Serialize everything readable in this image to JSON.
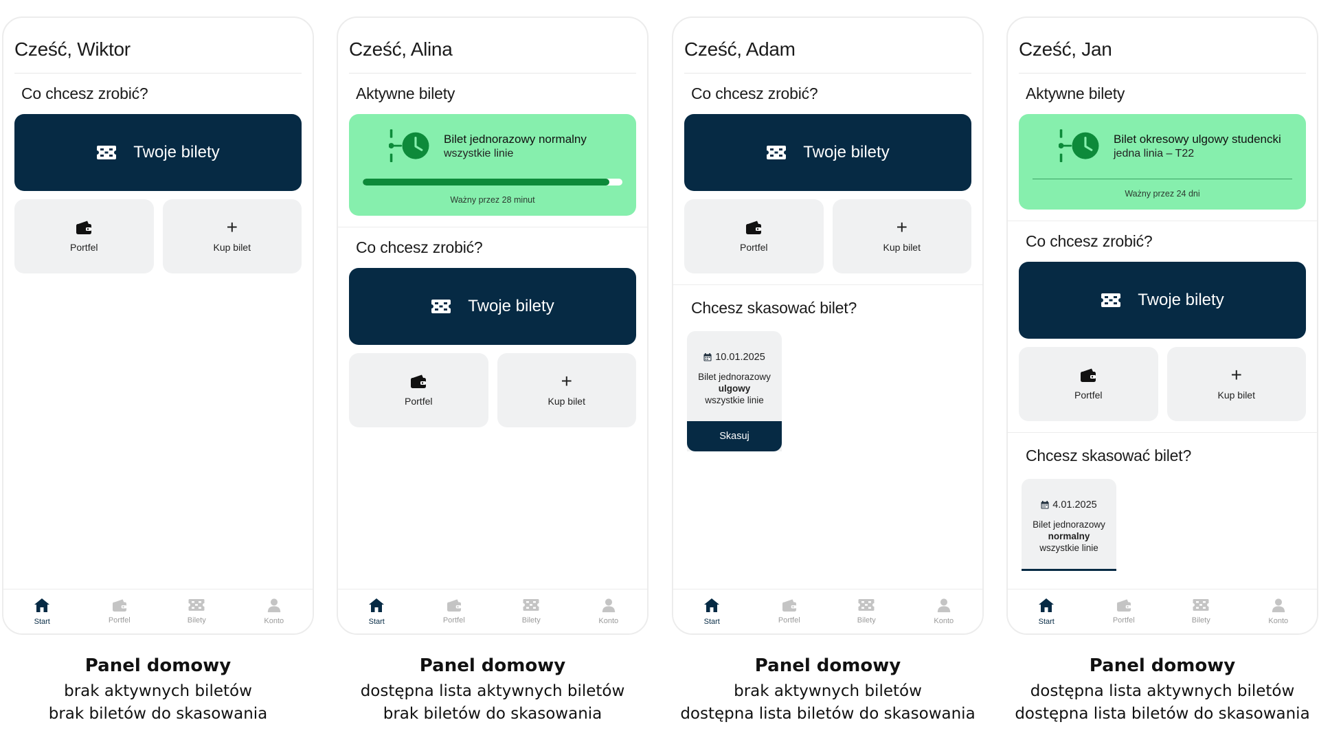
{
  "screens": [
    {
      "greeting": "Cześć, Wiktor",
      "actions_title": "Co chcesz zrobić?",
      "big_button": "Twoje bilety",
      "btn_wallet": "Portfel",
      "btn_buy": "Kup bilet",
      "nav": [
        "Start",
        "Portfel",
        "Bilety",
        "Konto"
      ]
    },
    {
      "greeting": "Cześć, Alina",
      "active_title": "Aktywne bilety",
      "active_ticket": {
        "title": "Bilet jednorazowy normalny",
        "subtitle": "wszystkie linie",
        "valid": "Ważny przez 28 minut",
        "progress": 0.95
      },
      "actions_title": "Co chcesz zrobić?",
      "big_button": "Twoje bilety",
      "btn_wallet": "Portfel",
      "btn_buy": "Kup bilet",
      "nav": [
        "Start",
        "Portfel",
        "Bilety",
        "Konto"
      ]
    },
    {
      "greeting": "Cześć, Adam",
      "actions_title": "Co chcesz zrobić?",
      "big_button": "Twoje bilety",
      "btn_wallet": "Portfel",
      "btn_buy": "Kup bilet",
      "validate_title": "Chcesz skasować bilet?",
      "validate_ticket": {
        "date": "10.01.2025",
        "line1": "Bilet jednorazowy",
        "line2": "ulgowy",
        "line3": "wszystkie linie",
        "button": "Skasuj"
      },
      "nav": [
        "Start",
        "Portfel",
        "Bilety",
        "Konto"
      ]
    },
    {
      "greeting": "Cześć, Jan",
      "active_title": "Aktywne bilety",
      "active_ticket": {
        "title": "Bilet okresowy ulgowy studencki",
        "subtitle": "jedna linia – T22",
        "valid": "Ważny przez 24 dni"
      },
      "actions_title": "Co chcesz zrobić?",
      "big_button": "Twoje bilety",
      "btn_wallet": "Portfel",
      "btn_buy": "Kup bilet",
      "validate_title": "Chcesz skasować bilet?",
      "validate_ticket": {
        "date": "4.01.2025",
        "line1": "Bilet jednorazowy",
        "line2": "normalny",
        "line3": "wszystkie linie"
      },
      "nav": [
        "Start",
        "Portfel",
        "Bilety",
        "Konto"
      ]
    }
  ],
  "captions": [
    {
      "title": "Panel domowy",
      "line1": "brak aktywnych biletów",
      "line2": "brak biletów do skasowania"
    },
    {
      "title": "Panel domowy",
      "line1": "dostępna lista aktywnych biletów",
      "line2": "brak biletów do skasowania"
    },
    {
      "title": "Panel domowy",
      "line1": "brak aktywnych biletów",
      "line2": "dostępna lista biletów do skasowania"
    },
    {
      "title": "Panel domowy",
      "line1": "dostępna lista aktywnych biletów",
      "line2": "dostępna lista biletów do skasowania"
    }
  ],
  "colors": {
    "primary": "#062a44",
    "active_card": "#86efad",
    "accent_green": "#0d8a3a",
    "light_button": "#f0f1f2"
  }
}
